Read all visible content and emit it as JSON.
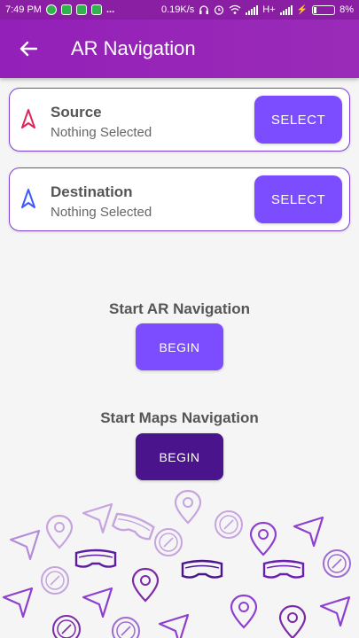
{
  "status_bar": {
    "time": "7:49 PM",
    "more": "...",
    "network_speed": "0.19K/s",
    "network_type": "H+",
    "battery": "8%"
  },
  "app_bar": {
    "title": "AR Navigation",
    "back_icon": "arrow-left-icon"
  },
  "source": {
    "label": "Source",
    "value": "Nothing Selected",
    "button": "SELECT",
    "icon": "navigation-arrow-icon",
    "icon_color": "#e0245e"
  },
  "destination": {
    "label": "Destination",
    "value": "Nothing Selected",
    "button": "SELECT",
    "icon": "navigation-arrow-icon",
    "icon_color": "#3d5afe"
  },
  "ar_navigation": {
    "title": "Start AR Navigation",
    "button": "BEGIN",
    "button_color": "#7c4dff"
  },
  "maps_navigation": {
    "title": "Start Maps Navigation",
    "button": "BEGIN",
    "button_color": "#4a148c"
  },
  "colors": {
    "app_bar": "#9320b8",
    "accent": "#7c4dff",
    "card_border": "#7c3fd8"
  }
}
